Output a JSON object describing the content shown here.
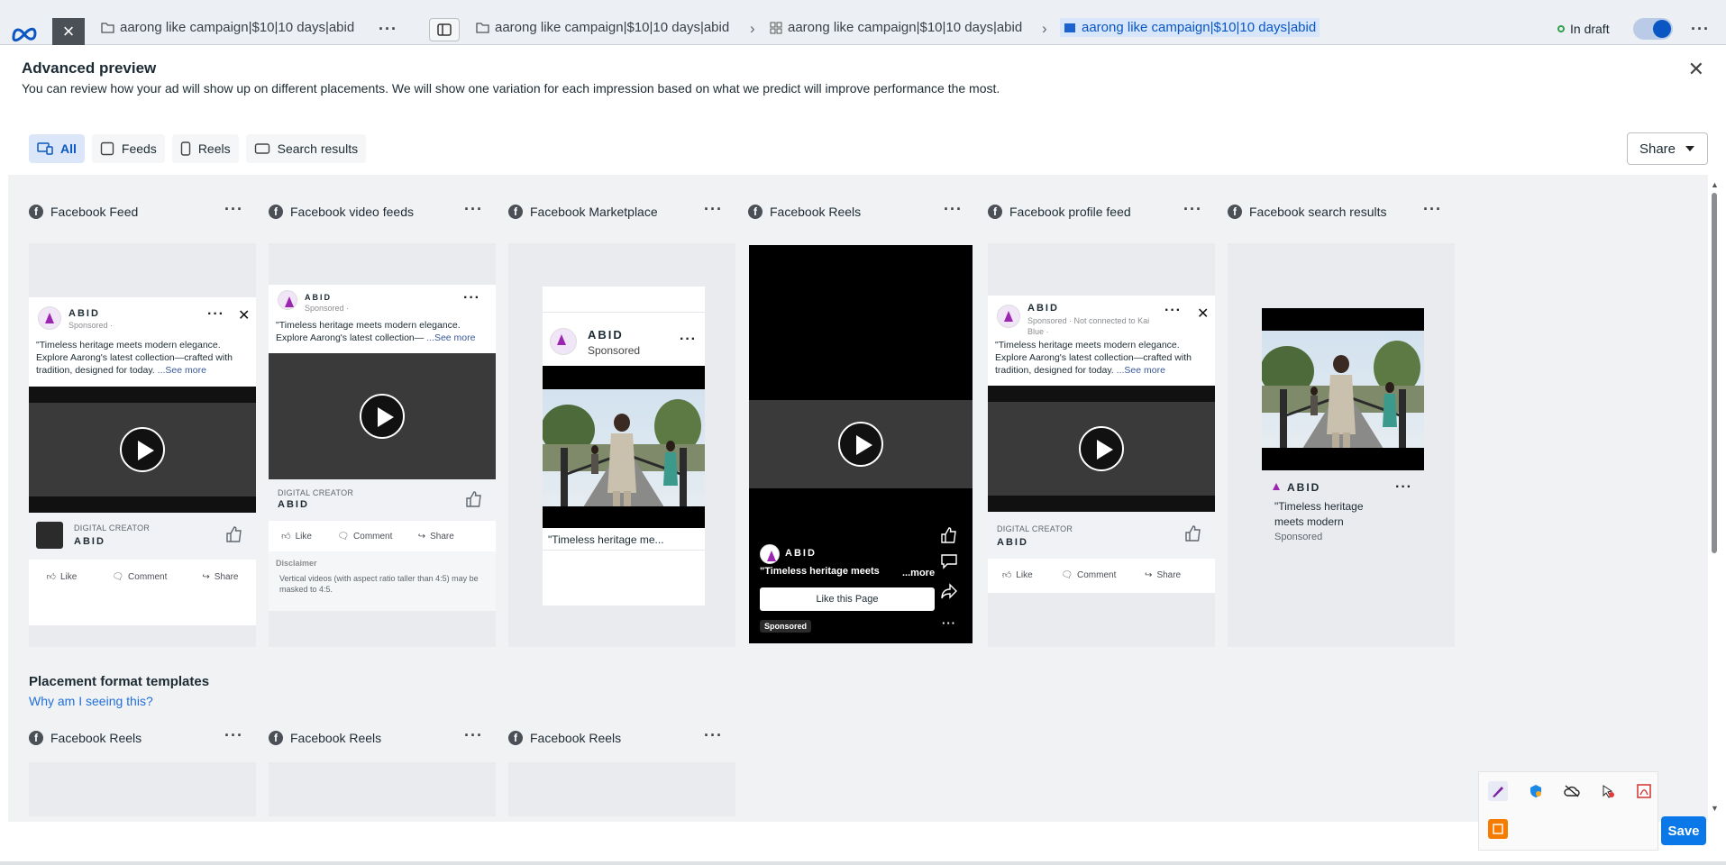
{
  "topbar": {
    "breadcrumb_1": "aarong like campaign|$10|10 days|abid",
    "breadcrumb_2": "aarong like campaign|$10|10 days|abid",
    "breadcrumb_3": "aarong like campaign|$10|10 days|abid",
    "breadcrumb_4": "aarong like campaign|$10|10 days|abid",
    "status": "In draft",
    "close_glyph": "×",
    "more_glyph": "···"
  },
  "modal": {
    "title": "Advanced preview",
    "subtitle": "You can review how your ad will show up on different placements. We will show one variation for each impression based on what we predict will improve performance the most.",
    "close_glyph": "✕",
    "filters": [
      {
        "label": "All",
        "icon": "devices-icon"
      },
      {
        "label": "Feeds",
        "icon": "feed-icon"
      },
      {
        "label": "Reels",
        "icon": "reels-icon"
      },
      {
        "label": "Search results",
        "icon": "search-results-icon"
      }
    ],
    "share_label": "Share",
    "placements": [
      {
        "name": "Facebook Feed"
      },
      {
        "name": "Facebook video feeds"
      },
      {
        "name": "Facebook Marketplace"
      },
      {
        "name": "Facebook Reels"
      },
      {
        "name": "Facebook profile feed"
      },
      {
        "name": "Facebook search results"
      }
    ],
    "templates_title": "Placement format templates",
    "why_link": "Why am I seeing this?",
    "template_placements": [
      {
        "name": "Facebook Reels"
      },
      {
        "name": "Facebook Reels"
      },
      {
        "name": "Facebook Reels"
      }
    ],
    "save_label": "Save"
  },
  "ad": {
    "page_name": "ABID",
    "page_name_reels": "ABID",
    "sponsored": "Sponsored · ",
    "sponsored_plain": "Sponsored",
    "sponsored_profile": "Sponsored · Not connected to Kai Blue · ",
    "body": "\"Timeless heritage meets modern elegance. Explore Aarong's latest collection—crafted with tradition, designed for today.",
    "body_short": "\"Timeless heritage meets modern elegance. Explore Aarong's latest collection—",
    "see_more": "...See more",
    "marketplace_caption": "\"Timeless heritage me...",
    "reels_caption": "\"Timeless heritage meets",
    "reels_more": "...more",
    "search_caption": "\"Timeless heritage meets modern",
    "cta_label": "DIGITAL CREATOR",
    "like": "Like",
    "comment": "Comment",
    "share": "Share",
    "like_page": "Like this Page",
    "disclaimer_title": "Disclaimer",
    "disclaimer_text": "Vertical videos (with aspect ratio taller than 4:5) may be masked to 4:5."
  },
  "colors": {
    "accent": "#0a78e8",
    "link": "#216fdb",
    "selected_chip": "#dbe7f9",
    "draft_dot": "#31a24c"
  }
}
